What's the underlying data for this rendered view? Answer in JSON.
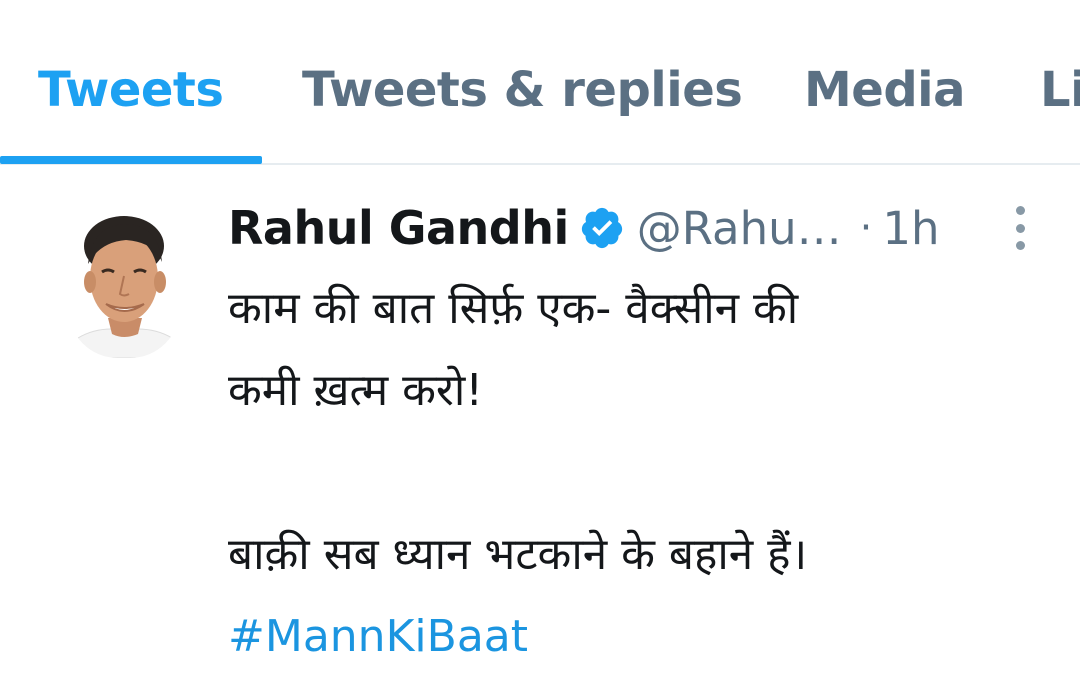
{
  "tabs": [
    {
      "label": "Tweets",
      "active": true
    },
    {
      "label": "Tweets & replies",
      "active": false
    },
    {
      "label": "Media",
      "active": false
    },
    {
      "label": "Li",
      "active": false
    }
  ],
  "tweet": {
    "author_name": "Rahul Gandhi",
    "verified": true,
    "handle": "@Rahu…",
    "separator": "·",
    "time": "1h",
    "lines": [
      "काम की बात सिर्फ़ एक- वैक्सीन की",
      "कमी ख़त्म करो!",
      "बाक़ी सब ध्यान भटकाने के बहाने हैं।"
    ],
    "hashtag": "#MannKiBaat"
  },
  "colors": {
    "accent": "#1da1f2",
    "muted": "#5b7083",
    "text": "#14171a",
    "hashtag": "#1b95e0"
  },
  "icons": {
    "verified": "verified-badge-icon",
    "more": "more-vertical-icon"
  }
}
